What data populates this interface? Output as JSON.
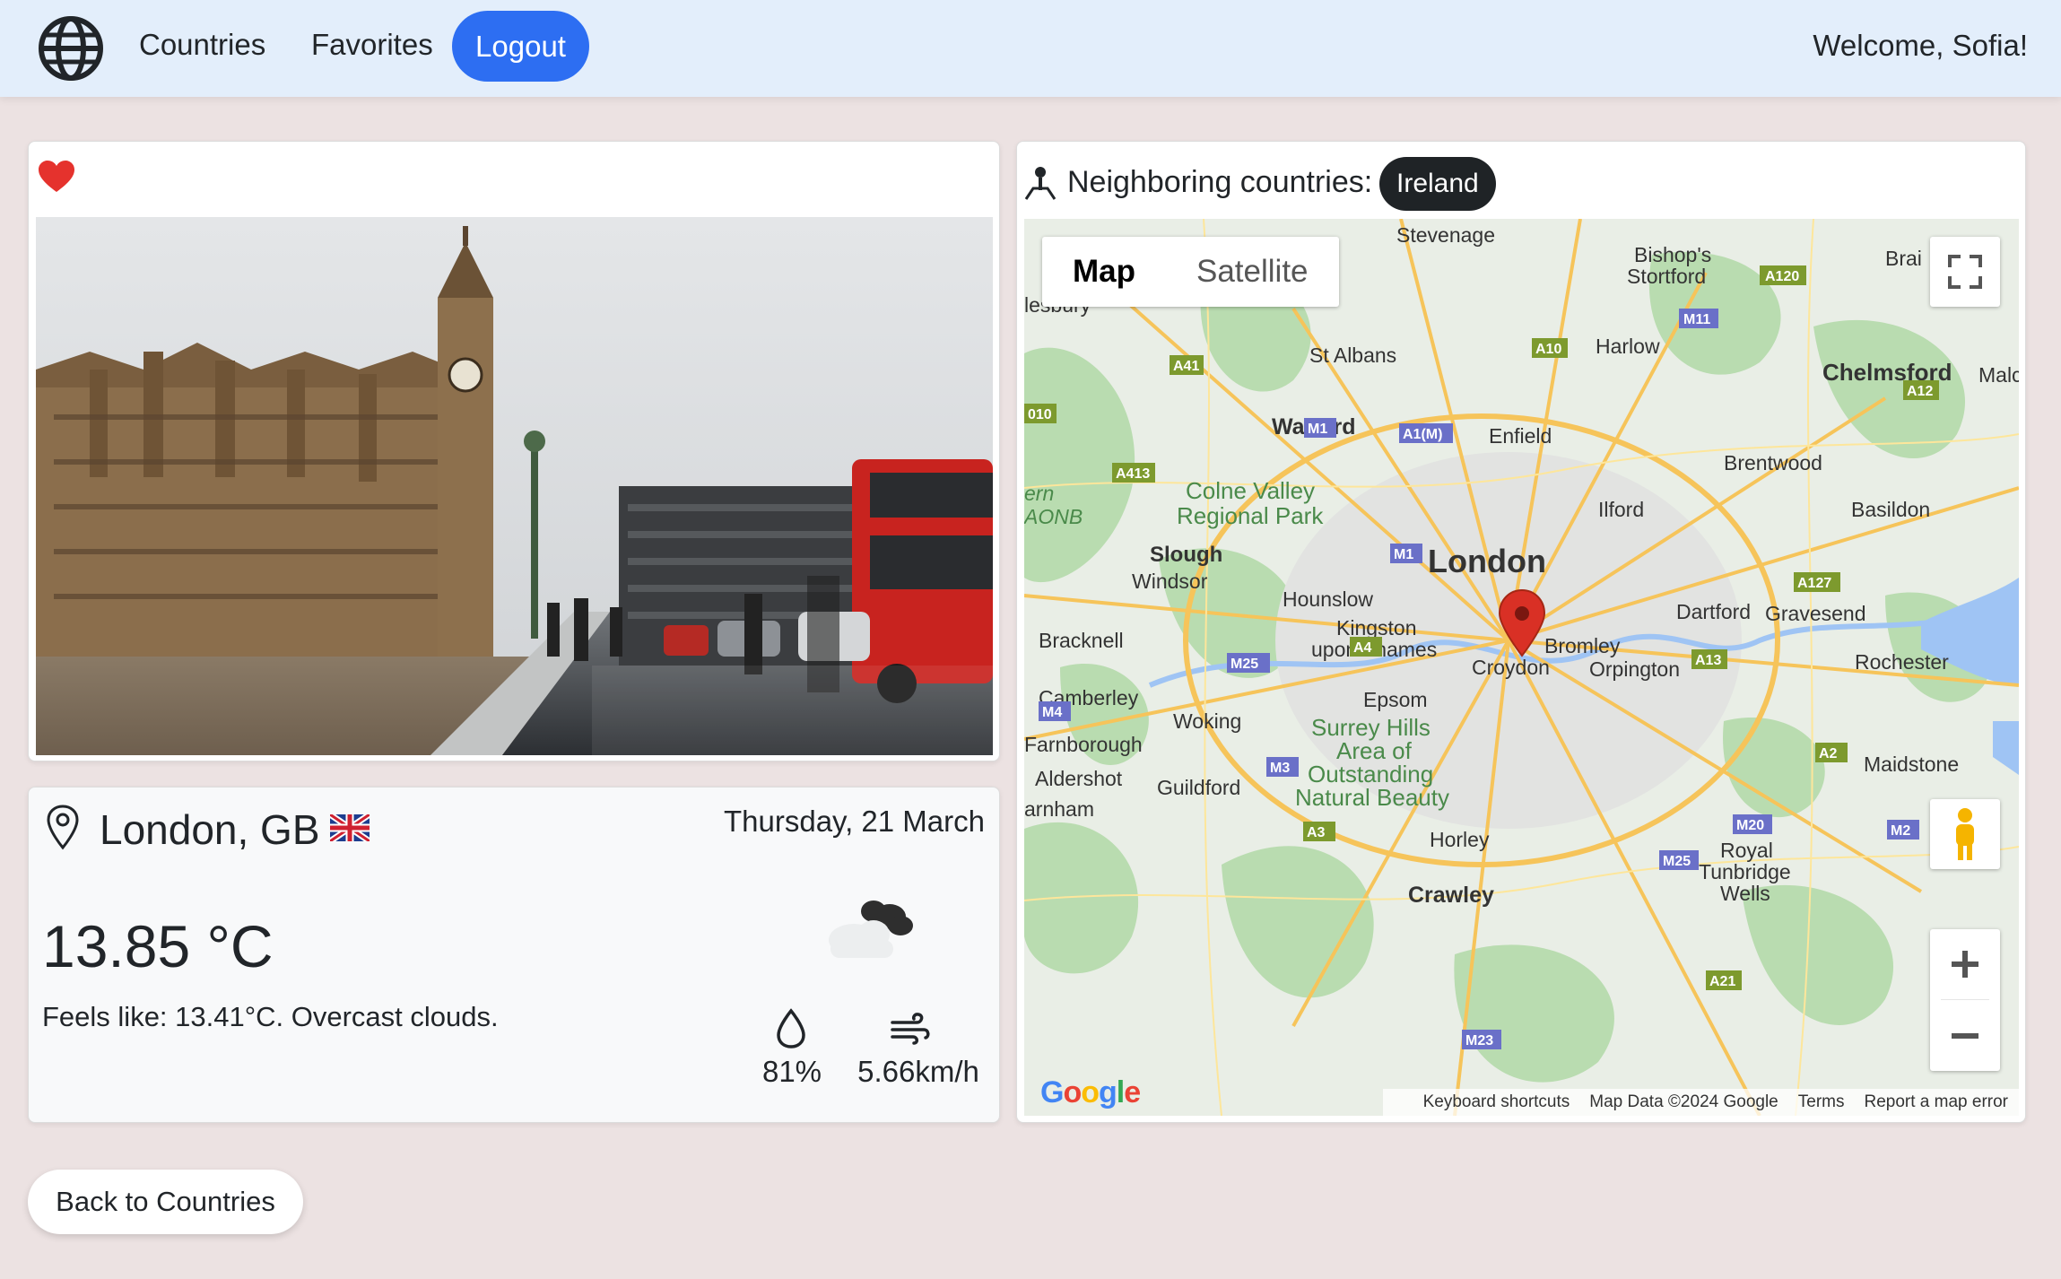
{
  "nav": {
    "logo_icon": "globe-icon",
    "countries": "Countries",
    "favorites": "Favorites",
    "logout": "Logout",
    "welcome": "Welcome, Sofia!"
  },
  "photo_card": {
    "favorite_icon": "heart-icon",
    "favorite_color": "#e5322d",
    "image_alt": "London Westminster street scene"
  },
  "weather": {
    "city": "London, GB",
    "flag_icon": "uk-flag-icon",
    "date": "Thursday, 21 March",
    "temperature": "13.85 °C",
    "feels_like": "Feels like: 13.41°C. Overcast clouds.",
    "condition_icon": "overcast-clouds-icon",
    "humidity": "81%",
    "wind": "5.66km/h"
  },
  "neighbors": {
    "label": "Neighboring countries:",
    "countries": [
      "Ireland"
    ]
  },
  "map": {
    "type_buttons": [
      "Map",
      "Satellite"
    ],
    "active_type": "Map",
    "marker_label": "London",
    "place_labels": [
      "Stevenage",
      "Bishop's",
      "Stortford",
      "Brai",
      "lesbury",
      "Harlow",
      "St Albans",
      "Chelmsford",
      "Malc",
      "Watford",
      "Enfield",
      "Brentwood",
      "Colne Valley",
      "Regional Park",
      "Ilford",
      "Basildon",
      "Slough",
      "London",
      "Windsor",
      "Hounslow",
      "Dartford",
      "Gravesend",
      "Bracknell",
      "Kingston",
      "upon Thames",
      "Bromley",
      "Croydon",
      "Orpington",
      "Rochester",
      "Camberley",
      "Epsom",
      "Woking",
      "Surrey Hills",
      "Area of",
      "Outstanding",
      "Natural Beauty",
      "Farnborough",
      "Maidstone",
      "Aldershot",
      "Guildford",
      "arnham",
      "Horley",
      "Royal",
      "Tunbridge",
      "Wells",
      "Crawley",
      "ern",
      "AONB"
    ],
    "road_labels": [
      "A120",
      "M11",
      "A10",
      "A41",
      "A1(M)",
      "M1",
      "A12",
      "A413",
      "010",
      "A127",
      "M25",
      "A4",
      "A13",
      "M4",
      "M3",
      "A2",
      "A3",
      "M20",
      "M2",
      "A21",
      "M23"
    ],
    "footer": [
      "Keyboard shortcuts",
      "Map Data ©2024 Google",
      "Terms",
      "Report a map error"
    ],
    "logo": "Google",
    "accent": "#d93025"
  },
  "back_button": "Back to Countries"
}
